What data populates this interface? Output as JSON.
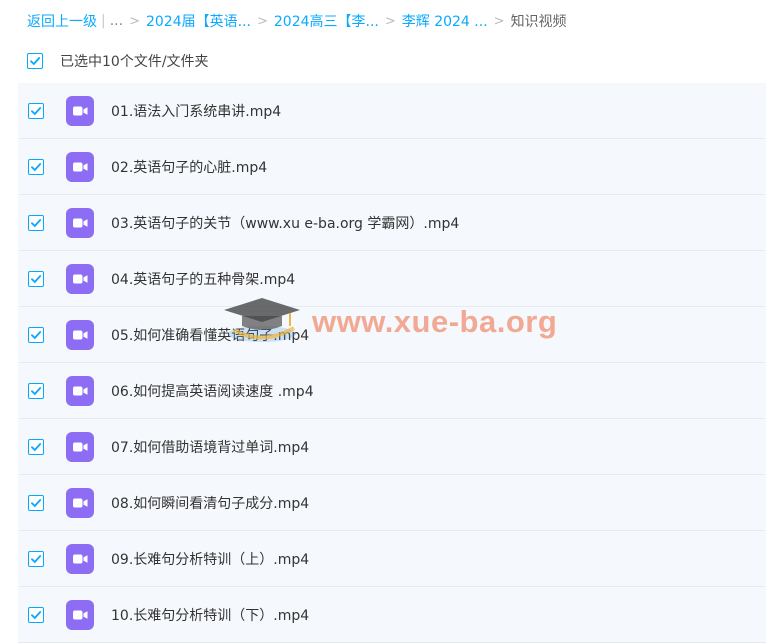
{
  "breadcrumb": {
    "back": "返回上一级",
    "ellipsis": "...",
    "crumb1": "2024届【英语...",
    "crumb2": "2024高三【李...",
    "crumb3": "李辉 2024 ...",
    "current": "知识视频",
    "separator": ">"
  },
  "selection": {
    "label": "已选中10个文件/文件夹",
    "all_checked": true
  },
  "files": [
    {
      "name": "01.语法入门系统串讲.mp4",
      "checked": true
    },
    {
      "name": "02.英语句子的心脏.mp4",
      "checked": true
    },
    {
      "name": "03.英语句子的关节（www.xu e-ba.org 学霸网）.mp4",
      "checked": true
    },
    {
      "name": "04.英语句子的五种骨架.mp4",
      "checked": true
    },
    {
      "name": "05.如何准确看懂英语句子.mp4",
      "checked": true
    },
    {
      "name": "06.如何提高英语阅读速度 .mp4",
      "checked": true
    },
    {
      "name": "07.如何借助语境背过单词.mp4",
      "checked": true
    },
    {
      "name": "08.如何瞬间看清句子成分.mp4",
      "checked": true
    },
    {
      "name": "09.长难句分析特训（上）.mp4",
      "checked": true
    },
    {
      "name": "10.长难句分析特训（下）.mp4",
      "checked": true
    }
  ],
  "watermark": {
    "text": "www.xue-ba.org"
  },
  "colors": {
    "link": "#09aaff",
    "checkbox": "#06a7ff",
    "video_icon": "#8c6df4",
    "row_bg": "#f5f8fd",
    "watermark": "#ee683c"
  },
  "icons": {
    "checkbox": "checkmark-icon",
    "file": "video-file-icon",
    "watermark": "graduation-cap-icon"
  }
}
